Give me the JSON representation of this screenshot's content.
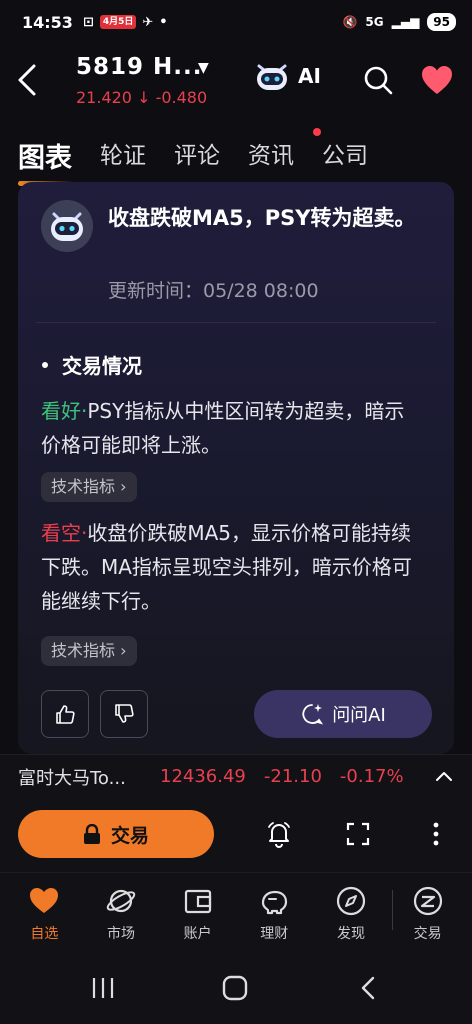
{
  "status_bar": {
    "time": "14:53",
    "badge": "4月5日",
    "network": "5G",
    "battery": "95"
  },
  "header": {
    "ticker": "5819 H...",
    "price": "21.420",
    "change": "-0.480",
    "ai_label": "AI"
  },
  "tabs": [
    {
      "label": "图表",
      "active": true
    },
    {
      "label": "轮证"
    },
    {
      "label": "评论"
    },
    {
      "label": "资讯"
    },
    {
      "label": "公司"
    }
  ],
  "card": {
    "headline": "收盘跌破MA5，PSY转为超卖。",
    "updated": "更新时间：05/28 08:00",
    "section_title": "交易情况",
    "bull_tag": "看好",
    "bull_text": "PSY指标从中性区间转为超卖，暗示价格可能即将上涨。",
    "bull_chip": "技术指标",
    "bear_tag": "看空",
    "bear_text": "收盘价跌破MA5，显示价格可能持续下跌。MA指标呈现空头排列，暗示价格可能继续下行。",
    "bear_chip": "技术指标",
    "ask_ai_label": "问问AI"
  },
  "index_bar": {
    "name": "富时大马To...",
    "value": "12436.49",
    "change": "-21.10",
    "percent": "-0.17%"
  },
  "action_bar": {
    "trade_label": "交易"
  },
  "bottom_nav": [
    {
      "label": "自选",
      "icon": "heart-icon",
      "active": true
    },
    {
      "label": "市场",
      "icon": "planet-icon"
    },
    {
      "label": "账户",
      "icon": "wallet-icon"
    },
    {
      "label": "理财",
      "icon": "piggy-bank-icon"
    },
    {
      "label": "发现",
      "icon": "compass-icon"
    },
    {
      "label": "交易",
      "icon": "trade-icon"
    }
  ],
  "colors": {
    "accent": "#f07a28",
    "down": "#e8404f",
    "up": "#3fc37a"
  }
}
